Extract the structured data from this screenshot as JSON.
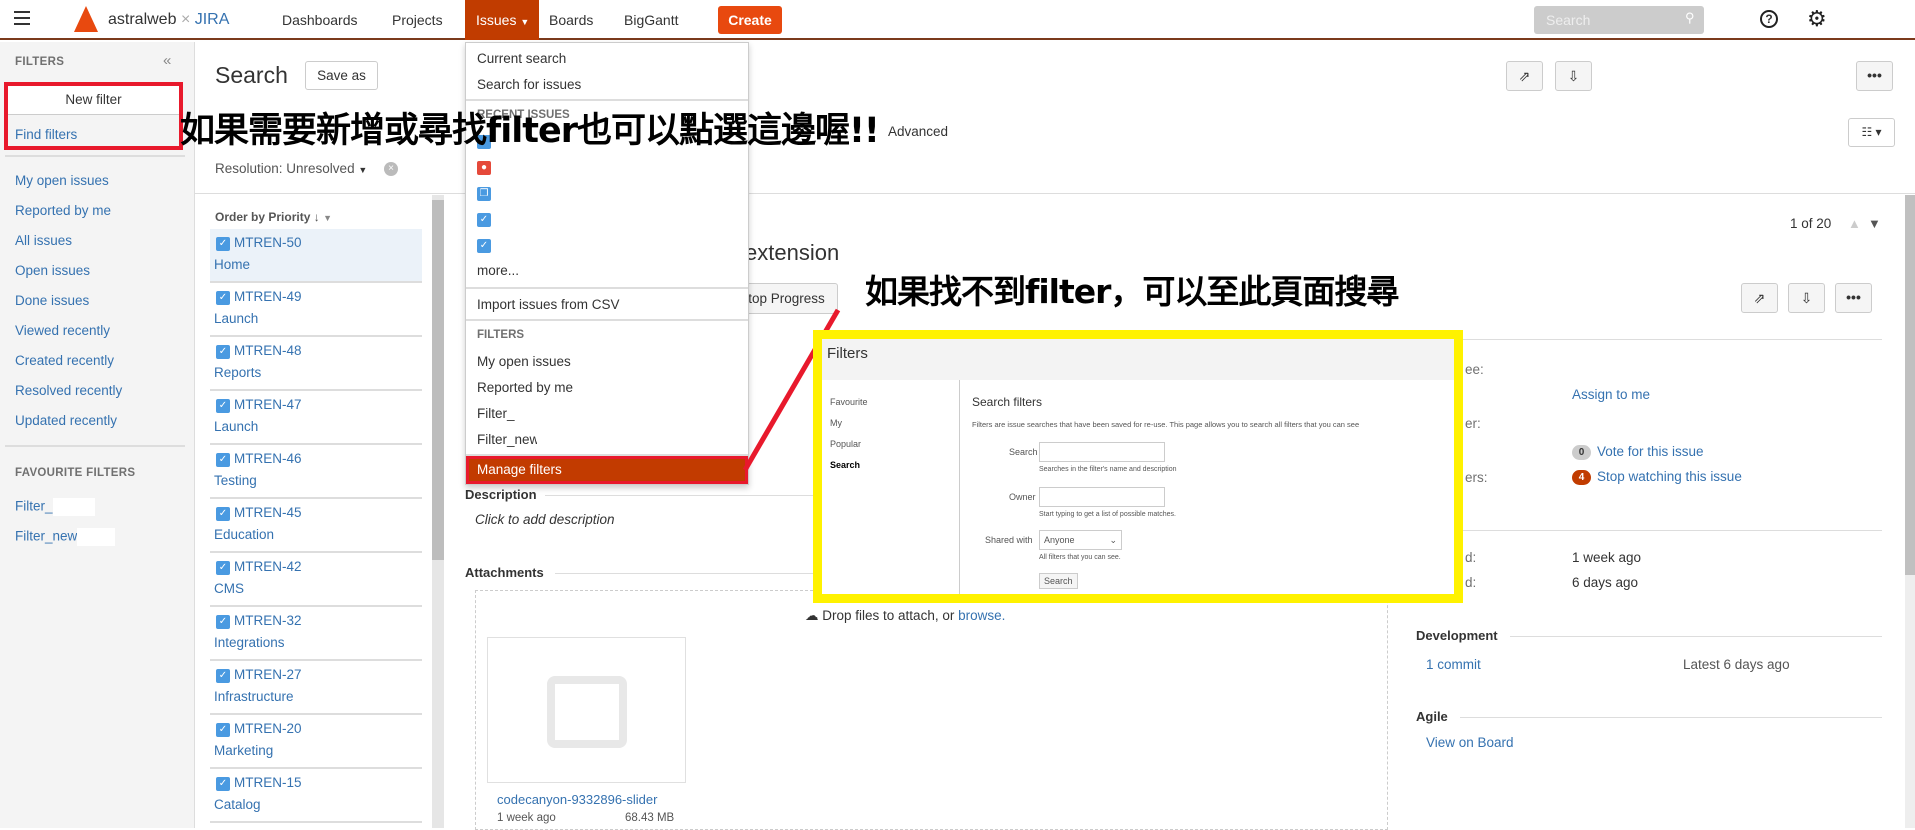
{
  "header": {
    "brand": "astralweb",
    "brand_sep": "×",
    "product": "JIRA",
    "nav": [
      "Dashboards",
      "Projects",
      "Issues",
      "Boards",
      "BigGantt"
    ],
    "create": "Create",
    "search_placeholder": "Search"
  },
  "sidebar": {
    "title": "FILTERS",
    "new_filter": "New filter",
    "find_filters": "Find filters",
    "items": [
      "My open issues",
      "Reported by me",
      "All issues",
      "Open issues",
      "Done issues",
      "Viewed recently",
      "Created recently",
      "Resolved recently",
      "Updated recently"
    ],
    "fav_title": "FAVOURITE FILTERS",
    "favs": [
      "Filter_",
      "Filter_new"
    ]
  },
  "search": {
    "title": "Search",
    "save_as": "Save as",
    "advanced": "Advanced",
    "resolution": "Resolution: Unresolved",
    "order": "Order by Priority"
  },
  "menu": {
    "current": "Current search",
    "search_issues": "Search for issues",
    "recent_header": "RECENT ISSUES",
    "more": "more...",
    "import": "Import issues from CSV",
    "filters_header": "FILTERS",
    "filters": [
      "My open issues",
      "Reported by me",
      "Filter_",
      "Filter_new"
    ],
    "manage": "Manage filters"
  },
  "issues": [
    {
      "key": "MTREN-50",
      "summary": "Home"
    },
    {
      "key": "MTREN-49",
      "summary": "Launch"
    },
    {
      "key": "MTREN-48",
      "summary": "Reports"
    },
    {
      "key": "MTREN-47",
      "summary": "Launch"
    },
    {
      "key": "MTREN-46",
      "summary": "Testing"
    },
    {
      "key": "MTREN-45",
      "summary": "Education"
    },
    {
      "key": "MTREN-42",
      "summary": "CMS"
    },
    {
      "key": "MTREN-32",
      "summary": "Integrations"
    },
    {
      "key": "MTREN-27",
      "summary": "Infrastructure"
    },
    {
      "key": "MTREN-20",
      "summary": "Marketing"
    },
    {
      "key": "MTREN-15",
      "summary": "Catalog"
    }
  ],
  "detail": {
    "pager": "1 of 20",
    "title": "extension",
    "stop_progress": "top Progress",
    "assign": "Assign to me",
    "votes": "0",
    "vote": "Vote for this issue",
    "watchers": "4",
    "watch": "Stop watching this issue",
    "created": "1 week ago",
    "updated": "6 days ago",
    "label_assignee": "ee:",
    "label_reporter": "er:",
    "label_watchers": "ers:",
    "label_created": "d:",
    "label_updated": "d:",
    "description": "Description",
    "desc_placeholder": "Click to add description",
    "attachments": "Attachments",
    "drop": "Drop files to attach, or ",
    "browse": "browse.",
    "file_name": "codecanyon-9332896-slider",
    "file_date": "1 week ago",
    "file_size": "68.43 MB",
    "development": "Development",
    "commit": "1 commit",
    "latest": "Latest 6 days ago",
    "agile": "Agile",
    "board": "View on Board"
  },
  "annotations": {
    "top": "如果需要新增或尋找filter也可以點選這邊喔!!",
    "middle": "如果找不到filter，可以至此頁面搜尋"
  },
  "filters_page": {
    "title": "Filters",
    "nav": [
      "Favourite",
      "My",
      "Popular",
      "Search"
    ],
    "heading": "Search filters",
    "intro": "Filters are issue searches that have been saved for re-use. This page allows you to search all filters that you can see",
    "search_label": "Search",
    "search_help": "Searches in the filter's name and description",
    "owner_label": "Owner",
    "owner_help": "Start typing to get a list of possible matches.",
    "shared_label": "Shared with",
    "shared_value": "Anyone",
    "shared_help": "All filters that you can see.",
    "search_button": "Search"
  },
  "colors": {
    "accent": "#c13c00",
    "highlight_box": "#fff200",
    "annotation_red": "#e8192c",
    "link": "#3572b0"
  }
}
